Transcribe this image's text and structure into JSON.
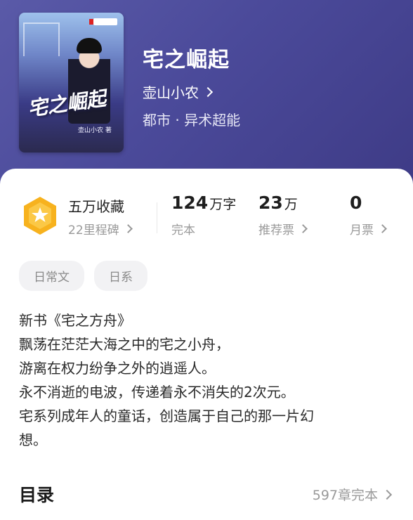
{
  "book": {
    "title": "宅之崛起",
    "author": "壶山小农",
    "genre": "都市 · 异术超能",
    "cover": {
      "title_text": "宅之崛起",
      "author_text": "壶山小农 著"
    }
  },
  "stats": {
    "collection": {
      "title": "五万收藏",
      "subtitle": "22里程碑"
    },
    "words": {
      "value": "124",
      "unit": "万字",
      "label": "完本"
    },
    "recommend": {
      "value": "23",
      "unit": "万",
      "label": "推荐票"
    },
    "monthly": {
      "value": "0",
      "label": "月票"
    }
  },
  "tags": [
    "日常文",
    "日系"
  ],
  "description": [
    "新书《宅之方舟》",
    "飘荡在茫茫大海之中的宅之小舟，",
    "游离在权力纷争之外的逍遥人。",
    "永不消逝的电波，传递着永不消失的2次元。",
    "宅系列成年人的童话，创造属于自己的那一片幻",
    "想。"
  ],
  "toc": {
    "title": "目录",
    "summary": "597章完本"
  },
  "colors": {
    "header_bg": "#4b4a9a",
    "badge_gold": "#f7b21e",
    "text_primary": "#222222",
    "text_secondary": "#999999"
  }
}
